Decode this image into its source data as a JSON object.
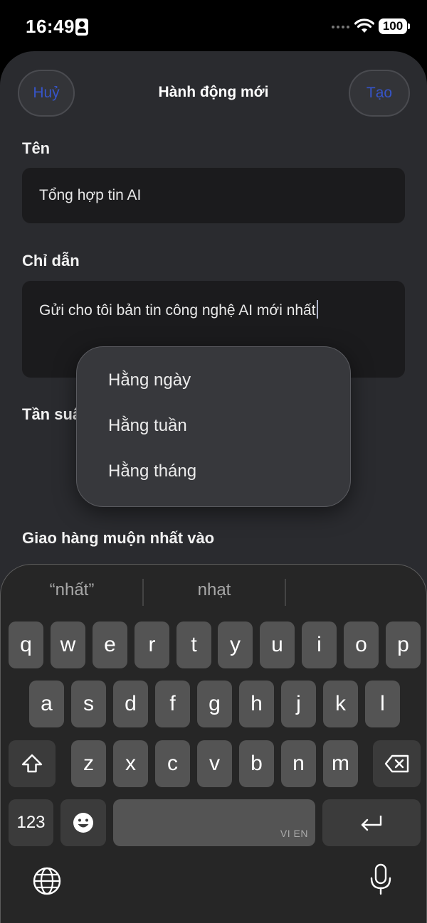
{
  "status": {
    "time": "16:49",
    "battery": "100"
  },
  "sheet": {
    "cancel_label": "Huỷ",
    "title": "Hành động mới",
    "create_label": "Tạo",
    "name_label": "Tên",
    "name_value": "Tổng hợp tin AI",
    "instructions_label": "Chỉ dẫn",
    "instructions_value": "Gửi cho tôi bản tin công nghệ AI mới nhất",
    "frequency_label": "Tần suất",
    "delivery_label": "Giao hàng muộn nhất vào"
  },
  "dropdown": {
    "options": [
      "Hằng ngày",
      "Hằng tuần",
      "Hằng tháng"
    ]
  },
  "keyboard": {
    "suggestions": [
      "“nhất”",
      "nhạt"
    ],
    "row1": [
      "q",
      "w",
      "e",
      "r",
      "t",
      "y",
      "u",
      "i",
      "o",
      "p"
    ],
    "row2": [
      "a",
      "s",
      "d",
      "f",
      "g",
      "h",
      "j",
      "k",
      "l"
    ],
    "row3": [
      "z",
      "x",
      "c",
      "v",
      "b",
      "n",
      "m"
    ],
    "numbers_label": "123",
    "space_lang": "VI EN",
    "icons": [
      "shift-icon",
      "delete-icon",
      "emoji-icon",
      "return-icon",
      "globe-icon",
      "microphone-icon"
    ]
  }
}
